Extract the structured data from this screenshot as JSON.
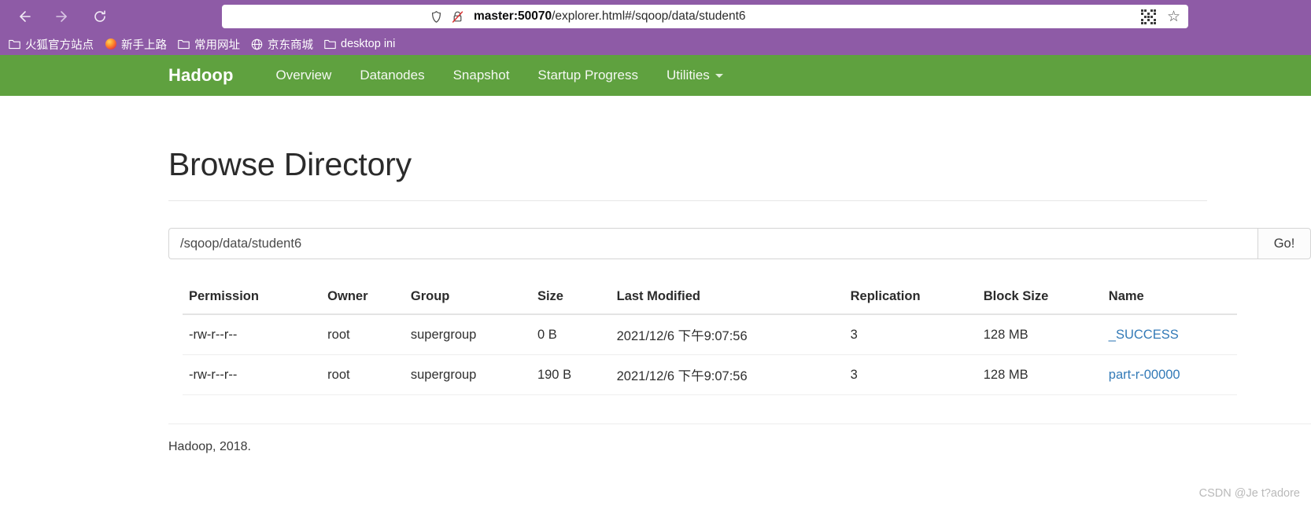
{
  "browser": {
    "back_label": "back-arrow",
    "forward_label": "forward-arrow",
    "reload_label": "reload",
    "url_host": "master:50070",
    "url_path": "/explorer.html#/sqoop/data/student6",
    "url_full": "master:50070/explorer.html#/sqoop/data/student6",
    "shield_icon": "shield-icon",
    "permission_icon": "blocked-permissions-icon",
    "qr_icon": "qr-code-icon",
    "bookmark_star_icon": "star-icon",
    "bookmarks": [
      {
        "label": "火狐官方站点",
        "icon": "folder-icon"
      },
      {
        "label": "新手上路",
        "icon": "firefox-icon"
      },
      {
        "label": "常用网址",
        "icon": "folder-icon"
      },
      {
        "label": "京东商城",
        "icon": "globe-icon"
      },
      {
        "label": "desktop ini",
        "icon": "folder-icon"
      }
    ]
  },
  "navbar": {
    "brand": "Hadoop",
    "links": [
      {
        "label": "Overview",
        "caret": false
      },
      {
        "label": "Datanodes",
        "caret": false
      },
      {
        "label": "Snapshot",
        "caret": false
      },
      {
        "label": "Startup Progress",
        "caret": false
      },
      {
        "label": "Utilities",
        "caret": true
      }
    ],
    "background_color": "#5fa13f"
  },
  "main": {
    "page_title": "Browse Directory",
    "path_value": "/sqoop/data/student6",
    "path_placeholder": "",
    "go_label": "Go!",
    "table": {
      "headers": [
        "Permission",
        "Owner",
        "Group",
        "Size",
        "Last Modified",
        "Replication",
        "Block Size",
        "Name"
      ],
      "rows": [
        {
          "permission": "-rw-r--r--",
          "owner": "root",
          "group": "supergroup",
          "size": "0 B",
          "last_modified": "2021/12/6 下午9:07:56",
          "replication": "3",
          "block_size": "128 MB",
          "name": "_SUCCESS"
        },
        {
          "permission": "-rw-r--r--",
          "owner": "root",
          "group": "supergroup",
          "size": "190 B",
          "last_modified": "2021/12/6 下午9:07:56",
          "replication": "3",
          "block_size": "128 MB",
          "name": "part-r-00000"
        }
      ]
    }
  },
  "footer": {
    "text": "Hadoop, 2018."
  },
  "watermark": {
    "text": "CSDN @Je t?adore"
  },
  "colors": {
    "browser_chrome": "#8e5ba6",
    "hadoop_green": "#5fa13f",
    "link_blue": "#337ab7"
  }
}
